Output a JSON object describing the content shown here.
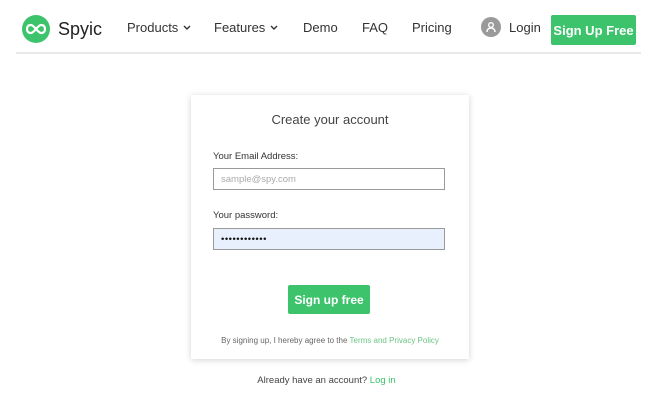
{
  "header": {
    "brand": "Spyic",
    "nav": [
      {
        "label": "Products"
      },
      {
        "label": "Features"
      },
      {
        "label": "Demo"
      },
      {
        "label": "FAQ"
      },
      {
        "label": "Pricing"
      }
    ],
    "login_label": "Login",
    "signup_label": "Sign Up Free"
  },
  "form": {
    "title": "Create your account",
    "email_label": "Your Email Address:",
    "email_placeholder": "sample@spy.com",
    "password_label": "Your password:",
    "password_value": "••••••••••••",
    "submit_label": "Sign up free",
    "terms_prefix": "By signing up, I hereby agree to the",
    "terms_link": "Terms and Privacy Policy"
  },
  "footer": {
    "already_text": "Already have an account?",
    "login_link": "Log in"
  },
  "colors": {
    "brand_green": "#3cc36b",
    "link_green": "#6cc486",
    "autofill_bg": "#e8f0fe"
  },
  "icons": [
    "infinity-logo-icon",
    "chevron-down-icon",
    "user-avatar-icon"
  ]
}
